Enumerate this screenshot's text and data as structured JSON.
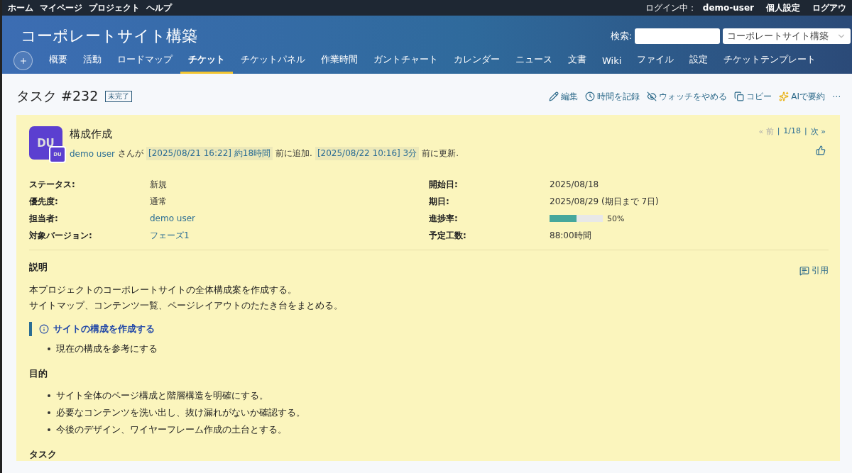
{
  "top_menu": {
    "left": [
      "ホーム",
      "マイページ",
      "プロジェクト",
      "ヘルプ"
    ],
    "login_label": "ログイン中：",
    "user": "demo-user",
    "right": [
      "個人設定",
      "ログアウ"
    ]
  },
  "header": {
    "title": "コーポレートサイト構築",
    "search_label": "検索:",
    "project_select": "コーポレートサイト構築"
  },
  "tabs": [
    {
      "label": "概要",
      "selected": false
    },
    {
      "label": "活動",
      "selected": false
    },
    {
      "label": "ロードマップ",
      "selected": false
    },
    {
      "label": "チケット",
      "selected": true
    },
    {
      "label": "チケットパネル",
      "selected": false
    },
    {
      "label": "作業時間",
      "selected": false
    },
    {
      "label": "ガントチャート",
      "selected": false
    },
    {
      "label": "カレンダー",
      "selected": false
    },
    {
      "label": "ニュース",
      "selected": false
    },
    {
      "label": "文書",
      "selected": false
    },
    {
      "label": "Wiki",
      "selected": false
    },
    {
      "label": "ファイル",
      "selected": false
    },
    {
      "label": "設定",
      "selected": false
    },
    {
      "label": "チケットテンプレート",
      "selected": false
    }
  ],
  "issue": {
    "title": "タスク #232",
    "status_badge": "未完了",
    "actions": [
      {
        "kind": "edit",
        "label": "編集"
      },
      {
        "kind": "time",
        "label": "時間を記録"
      },
      {
        "kind": "unwatch",
        "label": "ウォッチをやめる"
      },
      {
        "kind": "copy",
        "label": "コピー"
      },
      {
        "kind": "ai",
        "label": "AIで要約"
      },
      {
        "kind": "more",
        "label": "⋯"
      }
    ],
    "avatar": "DU",
    "avatar_small": "DU",
    "subject": "構成作成",
    "author": "demo user",
    "author_suffix": "さんが",
    "created": "[2025/08/21 16:22] 約18時間",
    "created_suffix": "前に追加.",
    "updated": "[2025/08/22 10:16] 3分",
    "updated_suffix": "前に更新.",
    "nav": {
      "prev": "« 前",
      "separator": "|",
      "position": "1/18",
      "next": "次 »"
    },
    "attributes_left": [
      {
        "label": "ステータス:",
        "value": "新規",
        "link": false
      },
      {
        "label": "優先度:",
        "value": "通常",
        "link": false
      },
      {
        "label": "担当者:",
        "value": "demo user",
        "link": true
      },
      {
        "label": "対象バージョン:",
        "value": "フェーズ1",
        "link": true
      }
    ],
    "attributes_right": [
      {
        "label": "開始日:",
        "value": "2025/08/18",
        "kind": "text"
      },
      {
        "label": "期日:",
        "value": "2025/08/29 (期日まで 7日)",
        "kind": "text"
      },
      {
        "label": "進捗率:",
        "value": "50%",
        "kind": "progress",
        "level": 0.5
      },
      {
        "label": "予定工数:",
        "value": "88:00時間",
        "kind": "text"
      }
    ],
    "description": {
      "heading": "説明",
      "quote": "引用",
      "paragraph": [
        "本プロジェクトのコーポレートサイトの全体構成案を作成する。",
        "サイトマップ、コンテンツ一覧、ページレイアウトのたたき台をまとめる。"
      ],
      "callout": "サイトの構成を作成する",
      "callout_items": [
        "現在の構成を参考にする"
      ],
      "purpose_heading": "目的",
      "purpose_items": [
        "サイト全体のページ構成と階層構造を明確にする。",
        "必要なコンテンツを洗い出し、抜け漏れがないか確認する。",
        "今後のデザイン、ワイヤーフレーム作成の土台とする。"
      ],
      "task_heading": "タスク"
    }
  }
}
